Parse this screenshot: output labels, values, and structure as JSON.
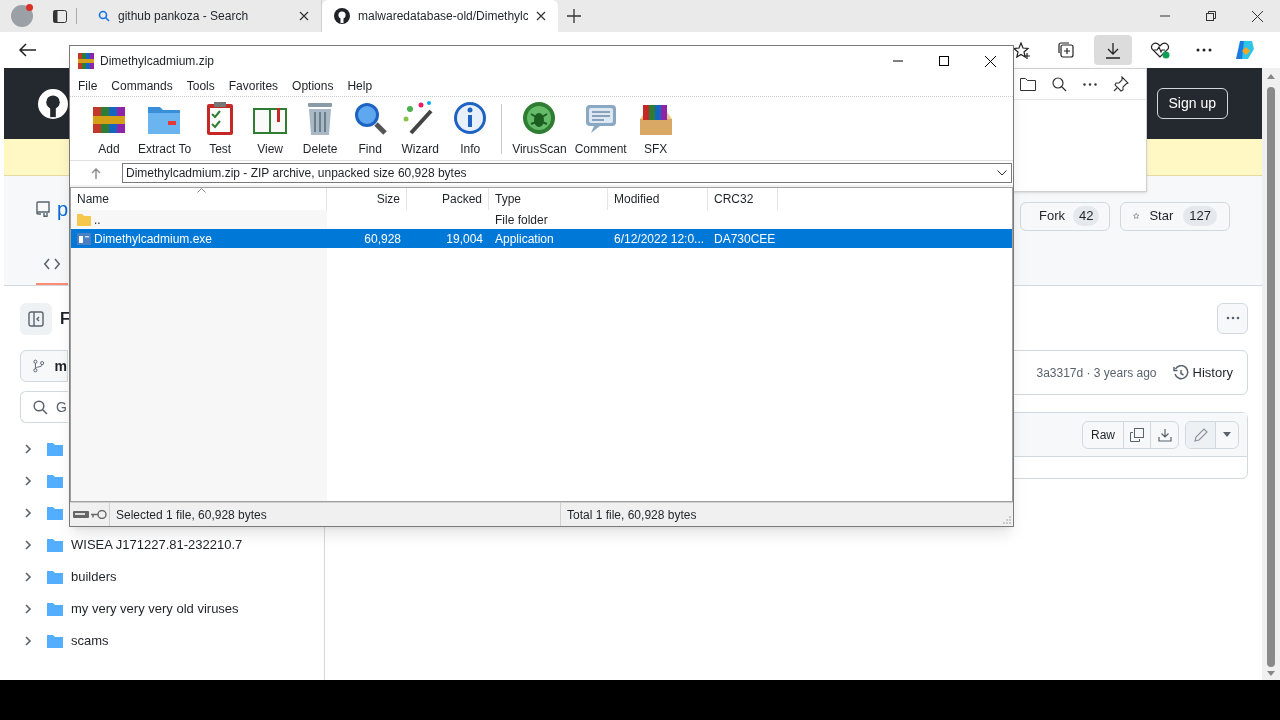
{
  "browser": {
    "tabs": [
      {
        "title": "github pankoza - Search",
        "selected": false
      },
      {
        "title": "malwaredatabase-old/Dimethylc",
        "selected": true
      }
    ]
  },
  "github": {
    "sign_up": "Sign up",
    "repo_name_fragment": "p",
    "fork": {
      "label": "Fork",
      "count": "42"
    },
    "star": {
      "label": "Star",
      "count": "127"
    },
    "files_heading_fragment": "F",
    "branch_fragment": "m",
    "search_fragment": "G",
    "tree": [
      {
        "expanded": false
      },
      {
        "expanded": false
      },
      {
        "expanded": false
      },
      {
        "name": "WISEA J171227.81-232210.7",
        "expanded": false
      },
      {
        "name": "builders",
        "expanded": false
      },
      {
        "name": "my very very very old viruses",
        "expanded": false
      },
      {
        "name": "scams",
        "expanded": false
      }
    ],
    "commit": "3a3317d · 3 years ago",
    "history": "History",
    "raw": "Raw"
  },
  "winrar": {
    "title": "Dimethylcadmium.zip",
    "menu": [
      "File",
      "Commands",
      "Tools",
      "Favorites",
      "Options",
      "Help"
    ],
    "toolbar": [
      "Add",
      "Extract To",
      "Test",
      "View",
      "Delete",
      "Find",
      "Wizard",
      "Info",
      "VirusScan",
      "Comment",
      "SFX"
    ],
    "path": "Dimethylcadmium.zip - ZIP archive, unpacked size 60,928 bytes",
    "columns": [
      "Name",
      "Size",
      "Packed",
      "Type",
      "Modified",
      "CRC32"
    ],
    "rows": [
      {
        "kind": "folder",
        "name": "..",
        "type": "File folder",
        "selected": false
      },
      {
        "kind": "file",
        "name": "Dimethylcadmium.exe",
        "size": "60,928",
        "packed": "19,004",
        "type": "Application",
        "modified": "6/12/2022 12:0...",
        "crc32": "DA730CEE",
        "selected": true
      }
    ],
    "status_left": "Selected 1 file, 60,928 bytes",
    "status_right": "Total 1 file, 60,928 bytes"
  }
}
